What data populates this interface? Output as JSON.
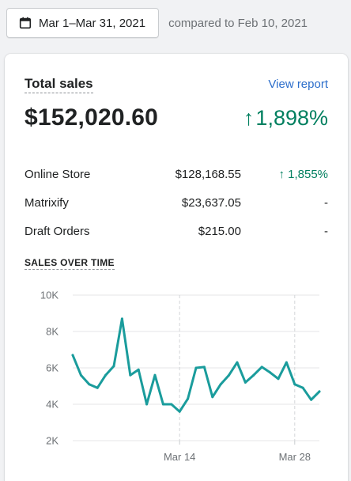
{
  "toolbar": {
    "date_range": "Mar 1–Mar 31, 2021",
    "compare_text": "compared to Feb 10, 2021"
  },
  "card": {
    "title": "Total sales",
    "view_report": "View report",
    "total": "$152,020.60",
    "total_change": "1,898%",
    "up_arrow": "↑",
    "rows": [
      {
        "name": "Online Store",
        "amount": "$128,168.55",
        "change": "↑ 1,855%",
        "trend": "up"
      },
      {
        "name": "Matrixify",
        "amount": "$23,637.05",
        "change": "-",
        "trend": "none"
      },
      {
        "name": "Draft Orders",
        "amount": "$215.00",
        "change": "-",
        "trend": "none"
      }
    ],
    "section_label": "SALES OVER TIME"
  },
  "colors": {
    "accent_link": "#2c6ecb",
    "positive": "#007f5f",
    "line": "#1a9c9c"
  },
  "chart_data": {
    "type": "line",
    "x": [
      "Mar 1",
      "Mar 2",
      "Mar 3",
      "Mar 4",
      "Mar 5",
      "Mar 6",
      "Mar 7",
      "Mar 8",
      "Mar 9",
      "Mar 10",
      "Mar 11",
      "Mar 12",
      "Mar 13",
      "Mar 14",
      "Mar 15",
      "Mar 16",
      "Mar 17",
      "Mar 18",
      "Mar 19",
      "Mar 20",
      "Mar 21",
      "Mar 22",
      "Mar 23",
      "Mar 24",
      "Mar 25",
      "Mar 26",
      "Mar 27",
      "Mar 28",
      "Mar 29",
      "Mar 30",
      "Mar 31"
    ],
    "y_ticks": [
      "10K",
      "8K",
      "6K",
      "4K",
      "2K"
    ],
    "x_ticks": [
      {
        "index": 13,
        "label": "Mar 14"
      },
      {
        "index": 27,
        "label": "Mar 28"
      }
    ],
    "ylim": [
      2000,
      10000
    ],
    "series": [
      {
        "values": [
          6700,
          5600,
          5100,
          4900,
          5600,
          6100,
          8700,
          5600,
          5900,
          4000,
          5600,
          4000,
          4000,
          3600,
          4300,
          6000,
          6050,
          4400,
          5100,
          5600,
          6300,
          5200,
          5600,
          6050,
          5750,
          5400,
          6300,
          5100,
          4900,
          4250,
          4700
        ]
      }
    ],
    "grid": true,
    "title": "",
    "xlabel": "",
    "ylabel": ""
  }
}
